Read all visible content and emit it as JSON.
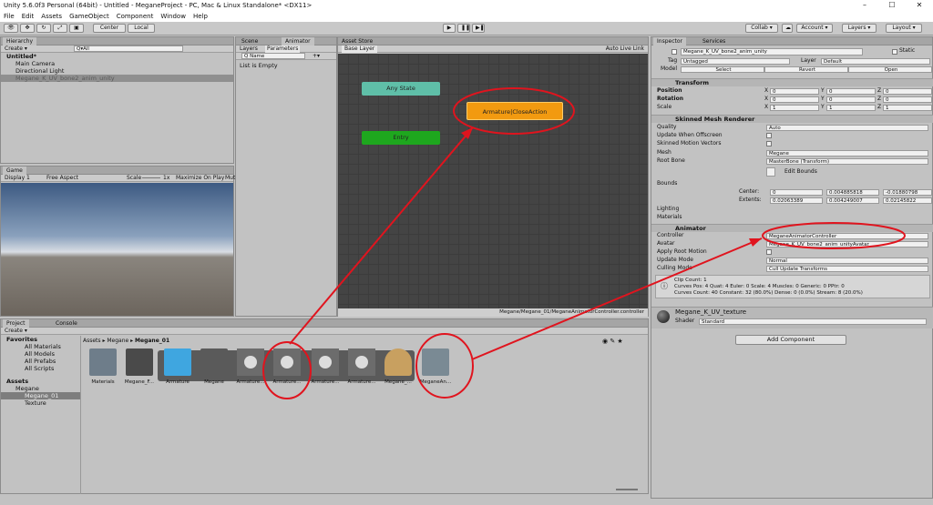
{
  "window": {
    "title": "Unity 5.6.0f3 Personal (64bit) - Untitled - MeganeProject - PC, Mac & Linux Standalone* <DX11>",
    "controls": [
      "–",
      "☐",
      "✕"
    ]
  },
  "menu": [
    "File",
    "Edit",
    "Assets",
    "GameObject",
    "Component",
    "Window",
    "Help"
  ],
  "toolbar": {
    "center": "Center",
    "local": "Local",
    "collab": "Collab ▾",
    "account": "Account ▾",
    "layers": "Layers ▾",
    "layout": "Layout ▾",
    "play": "▶",
    "pause": "❚❚",
    "step": "▶❚"
  },
  "hierarchy": {
    "tab": "Hierarchy",
    "create": "Create ▾",
    "search": "Q▾All",
    "scene": "Untitled*",
    "items": [
      "Main Camera",
      "Directional Light",
      "Megane_K_UV_bone2_anim_unity"
    ]
  },
  "game": {
    "tab": "Game",
    "display": "Display 1",
    "aspect": "Free Aspect",
    "scale_label": "Scale",
    "scale": "1x",
    "maximize": "Maximize On Play",
    "mute": "Mute"
  },
  "animator": {
    "tabs": [
      "Scene",
      "Animator",
      "Asset Store"
    ],
    "layers_tab": "Layers",
    "params_tab": "Parameters",
    "search": "Q Name",
    "list_empty": "List is Empty",
    "base_layer": "Base Layer",
    "auto_live": "Auto Live Link",
    "path": "Megane/Megane_01/MeganeAnimatorController.controller",
    "nodes": {
      "any": "Any State",
      "action": "Armature|CloseAction",
      "entry": "Entry"
    }
  },
  "project": {
    "tabs": [
      "Project",
      "Console"
    ],
    "create": "Create ▾",
    "favorites": "Favorites",
    "fav_items": [
      "All Materials",
      "All Models",
      "All Prefabs",
      "All Scripts"
    ],
    "assets": "Assets",
    "tree": [
      "Megane",
      "Megane_01",
      "Texture"
    ],
    "breadcrumb": [
      "Assets",
      "Megane",
      "Megane_01"
    ],
    "items": [
      "Materials",
      "Megane_F...",
      "Armature",
      "Megane",
      "Armature...",
      "Armature...",
      "Armature...",
      "Armature...",
      "Megane_...",
      "MeganeAn..."
    ]
  },
  "inspector": {
    "tabs": [
      "Inspector",
      "Services"
    ],
    "object_name": "Megane_K_UV_bone2_anim_unity",
    "static": "Static",
    "tag_label": "Tag",
    "tag": "Untagged",
    "layer_label": "Layer",
    "layer": "Default",
    "model_label": "Model",
    "select": "Select",
    "revert": "Revert",
    "open": "Open",
    "transform": {
      "title": "Transform",
      "position": "Position",
      "rotation": "Rotation",
      "scale": "Scale",
      "pos": [
        "0",
        "0",
        "0"
      ],
      "rot": [
        "0",
        "0",
        "0"
      ],
      "scl": [
        "1",
        "1",
        "1"
      ],
      "xyz": [
        "X",
        "Y",
        "Z"
      ]
    },
    "smr": {
      "title": "Skinned Mesh Renderer",
      "quality_label": "Quality",
      "quality": "Auto",
      "update_offscreen": "Update When Offscreen",
      "skinned_motion": "Skinned Motion Vectors",
      "mesh_label": "Mesh",
      "mesh": "Megane",
      "root_bone_label": "Root Bone",
      "root_bone": "MasterBone (Transform)",
      "edit_bounds": "Edit Bounds",
      "bounds": "Bounds",
      "center": "Center:",
      "extents": "Extents:",
      "center_vals": [
        "0",
        "0.004885818",
        "-0.01880798"
      ],
      "extent_vals": [
        "0.02063389",
        "0.004249007",
        "0.02145822"
      ],
      "lighting": "Lighting",
      "materials": "Materials"
    },
    "anim": {
      "title": "Animator",
      "controller_label": "Controller",
      "controller": "MeganeAnimatorController",
      "avatar_label": "Avatar",
      "avatar": "Megane_K_UV_bone2_anim_unityAvatar",
      "root_motion": "Apply Root Motion",
      "update_mode_label": "Update Mode",
      "update_mode": "Normal",
      "culling_label": "Culling Mode",
      "culling": "Cull Update Transforms",
      "info": [
        "Clip Count: 1",
        "Curves Pos: 4 Quat: 4 Euler: 0 Scale: 4 Muscles: 0 Generic: 0 PPtr: 0",
        "Curves Count: 40 Constant: 32 (80.0%) Dense: 0 (0.0%) Stream: 8 (20.0%)"
      ]
    },
    "material": {
      "name": "Megane_K_UV_texture",
      "shader_label": "Shader",
      "shader": "Standard"
    },
    "add_component": "Add Component"
  },
  "colors": {
    "any_state": "#5fbfa8",
    "action": "#f29a10",
    "entry": "#1ea71e",
    "annotation": "#e0141e"
  }
}
